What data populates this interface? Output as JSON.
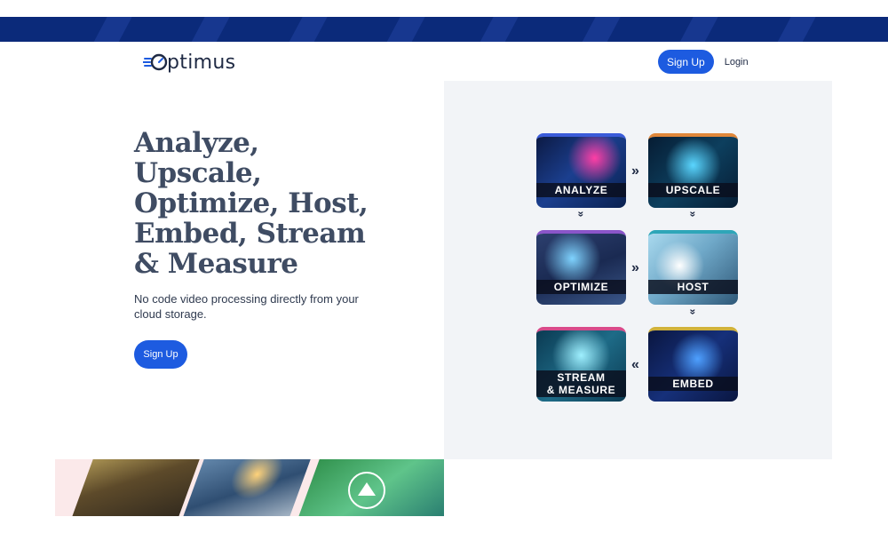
{
  "header": {
    "logo_text": "ptimus",
    "signup_label": "Sign Up",
    "login_label": "Login"
  },
  "hero": {
    "title": "Analyze,\nUpscale,\nOptimize, Host,\nEmbed, Stream\n& Measure",
    "subtitle": "No code video processing directly from your cloud storage.",
    "signup_label": "Sign Up"
  },
  "workflow": {
    "tiles": [
      {
        "label": "ANALYZE",
        "accent": "#3a5bd9"
      },
      {
        "label": "UPSCALE",
        "accent": "#e0873a"
      },
      {
        "label": "OPTIMIZE",
        "accent": "#8a55c9"
      },
      {
        "label": "HOST",
        "accent": "#2ea6b8"
      },
      {
        "label": "STREAM\n& MEASURE",
        "accent": "#d94a8a"
      },
      {
        "label": "EMBED",
        "accent": "#d1b23a"
      }
    ],
    "arrows": {
      "right": "»",
      "left": "«",
      "down": "»"
    }
  },
  "colors": {
    "brand_blue": "#1d5be0",
    "banner_navy": "#0b2a7a",
    "panel_bg": "#f2f4f7",
    "heading": "#3f4c63"
  },
  "icons": {
    "logo": "speedometer-o-icon",
    "play": "play-icon"
  }
}
